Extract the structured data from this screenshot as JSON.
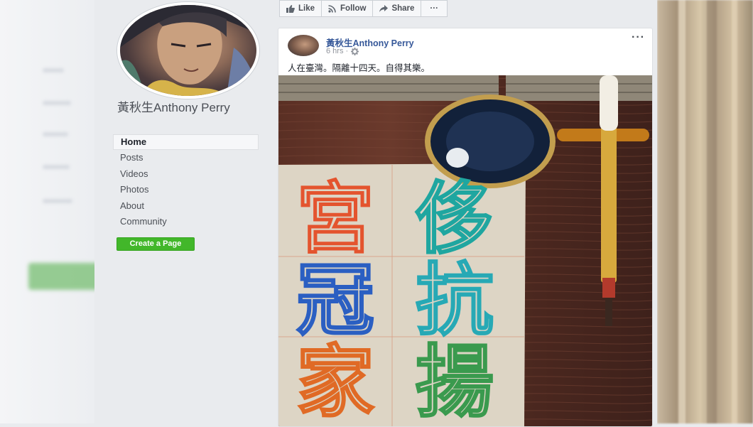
{
  "page": {
    "name": "黃秋生Anthony Perry",
    "nav": [
      "Home",
      "Posts",
      "Videos",
      "Photos",
      "About",
      "Community"
    ],
    "active_nav": "Home",
    "create_page_label": "Create a Page"
  },
  "actions": {
    "like": "Like",
    "follow": "Follow",
    "share": "Share",
    "more": "···"
  },
  "post": {
    "author": "黃秋生Anthony Perry",
    "time": "6 hrs ·",
    "menu": "···",
    "text": "人在臺灣。隔離十四天。自得其樂。",
    "photo_characters": [
      "宮",
      "侈",
      "冠",
      "抗",
      "家",
      "揚"
    ]
  },
  "colors": {
    "accent": "#365899",
    "create_button": "#42b72a",
    "background": "#e9ebee"
  }
}
